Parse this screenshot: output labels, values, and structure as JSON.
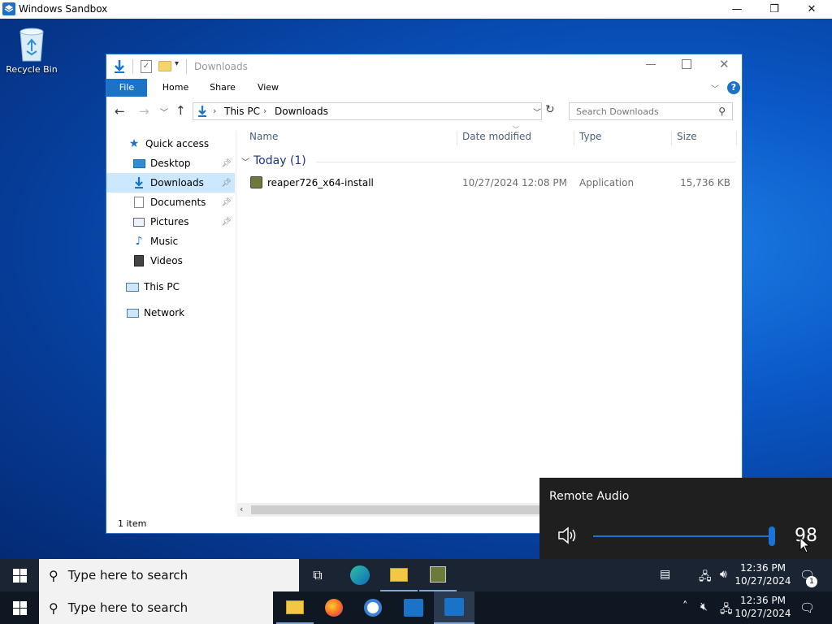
{
  "sandbox": {
    "title": "Windows Sandbox",
    "minimize": "—",
    "maximize": "❐",
    "close": "✕"
  },
  "desktop": {
    "recycle_bin_label": "Recycle Bin"
  },
  "explorer": {
    "title": "Downloads",
    "ribbon_tabs": [
      "File",
      "Home",
      "Share",
      "View"
    ],
    "breadcrumb": [
      "This PC",
      "Downloads"
    ],
    "search_placeholder": "Search Downloads",
    "nav": {
      "quick_access": "Quick access",
      "items": [
        {
          "label": "Desktop",
          "pinned": true
        },
        {
          "label": "Downloads",
          "pinned": true,
          "selected": true
        },
        {
          "label": "Documents",
          "pinned": true
        },
        {
          "label": "Pictures",
          "pinned": true
        },
        {
          "label": "Music",
          "pinned": false
        },
        {
          "label": "Videos",
          "pinned": false
        }
      ],
      "this_pc": "This PC",
      "network": "Network"
    },
    "columns": [
      "Name",
      "Date modified",
      "Type",
      "Size"
    ],
    "group_header": "Today (1)",
    "files": [
      {
        "name": "reaper726_x64-install",
        "date": "10/27/2024 12:08 PM",
        "type": "Application",
        "size": "15,736 KB"
      }
    ],
    "status": "1 item"
  },
  "audio_flyout": {
    "title": "Remote Audio",
    "volume": 98,
    "volume_label": "98"
  },
  "taskbar_top": {
    "search_placeholder": "Type here to search",
    "time": "12:36 PM",
    "date": "10/27/2024",
    "notifications": "1"
  },
  "taskbar_bottom": {
    "search_placeholder": "Type here to search",
    "time": "12:36 PM",
    "date": "10/27/2024"
  },
  "colors": {
    "accent": "#1a73c6",
    "selection": "#cce8ff",
    "flyout_bg": "#1f1f1f",
    "slider": "#1a73d6"
  }
}
